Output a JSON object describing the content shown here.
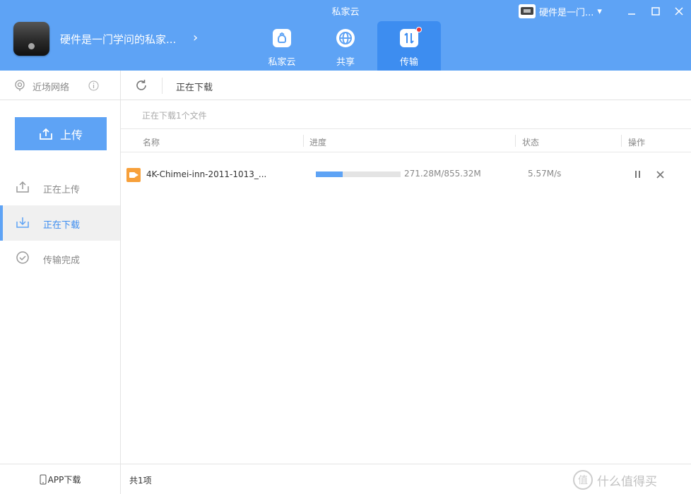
{
  "window": {
    "title": "私家云"
  },
  "header": {
    "device_name": "硬件是一门学问的私家...",
    "device_chevron": "›",
    "tabs": [
      {
        "label": "私家云",
        "icon": "cloud-home-icon",
        "active": false
      },
      {
        "label": "共享",
        "icon": "share-globe-icon",
        "active": false
      },
      {
        "label": "传输",
        "icon": "transfer-icon",
        "active": true,
        "badge": true
      }
    ],
    "user": {
      "name": "硬件是一门...",
      "dropdown": "▾"
    }
  },
  "sidebar": {
    "near_network": "近场网络",
    "upload_button": "上传",
    "items": [
      {
        "label": "正在上传",
        "icon": "upload-icon",
        "active": false
      },
      {
        "label": "正在下载",
        "icon": "download-icon",
        "active": true
      },
      {
        "label": "传输完成",
        "icon": "check-circle-icon",
        "active": false
      }
    ],
    "app_download": "APP下载"
  },
  "main": {
    "toolbar_title": "正在下载",
    "summary": "正在下载1个文件",
    "columns": [
      "名称",
      "进度",
      "状态",
      "操作"
    ],
    "rows": [
      {
        "name": "4K-Chimei-inn-2011-1013_...",
        "progress_fraction": 0.317,
        "progress_text": "271.28M/855.32M",
        "speed": "5.57M/s"
      }
    ],
    "footer_count": "共1项"
  },
  "watermark": {
    "text": "什么值得买",
    "mark": "值"
  },
  "colors": {
    "accent": "#5ea3f5",
    "accent_dark": "#3d8df0",
    "file_icon": "#f7a03a",
    "badge": "#e33333"
  }
}
